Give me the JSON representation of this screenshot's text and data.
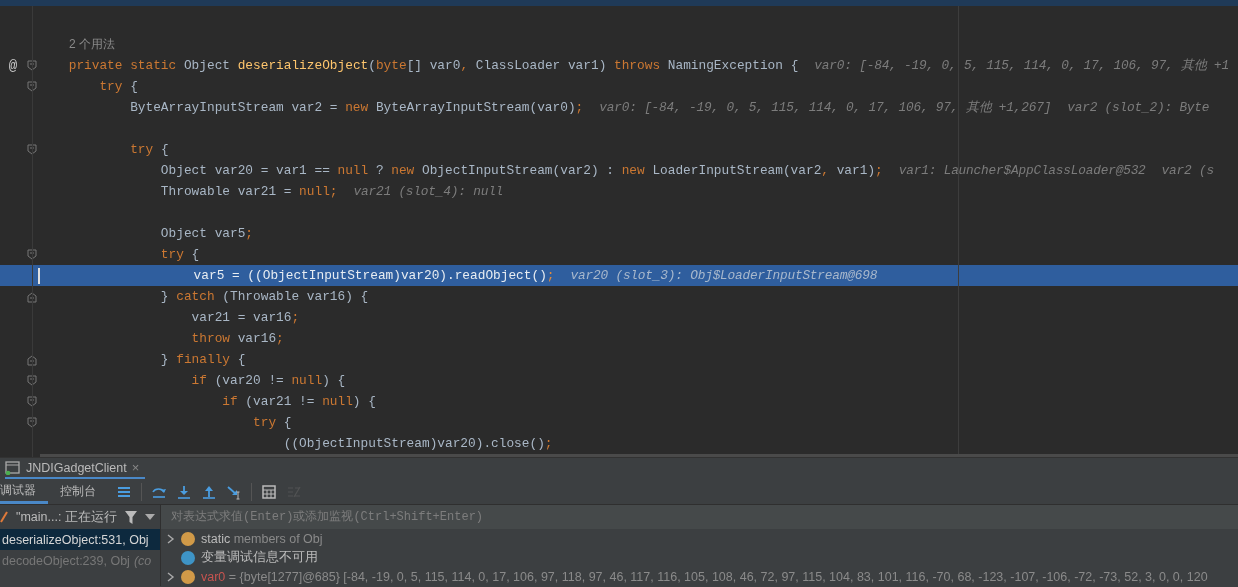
{
  "editor": {
    "lines": [
      {
        "usage": "2 个用法",
        "foldable": false,
        "highlighted": false
      },
      {
        "marker": "@",
        "tokens": [
          {
            "kind": "kw",
            "text": "    private static "
          },
          {
            "kind": "txt",
            "text": "Object "
          },
          {
            "kind": "fn",
            "text": "deserializeObject"
          },
          {
            "kind": "txt",
            "text": "("
          },
          {
            "kind": "kw",
            "text": "byte"
          },
          {
            "kind": "txt",
            "text": "[] var0"
          },
          {
            "kind": "kw",
            "text": ", "
          },
          {
            "kind": "txt",
            "text": "ClassLoader var1) "
          },
          {
            "kind": "kw",
            "text": "throws "
          },
          {
            "kind": "txt",
            "text": "NamingException {"
          }
        ],
        "hints": [
          "var0: [-84, -19, 0, 5, 115, 114, 0, 17, 106, 97, 其他 +1"
        ],
        "foldable": true,
        "fold_end": false,
        "highlighted": false
      },
      {
        "tokens": [
          {
            "kind": "kw",
            "text": "        try "
          },
          {
            "kind": "txt",
            "text": "{"
          }
        ],
        "foldable": true,
        "fold_end": false,
        "highlighted": false
      },
      {
        "tokens": [
          {
            "kind": "txt",
            "text": "            ByteArrayInputStream var2 = "
          },
          {
            "kind": "kw",
            "text": "new "
          },
          {
            "kind": "txt",
            "text": "ByteArrayInputStream(var0)"
          },
          {
            "kind": "kw",
            "text": ";"
          }
        ],
        "hints": [
          "var0: [-84, -19, 0, 5, 115, 114, 0, 17, 106, 97, 其他 +1,267]",
          "var2 (slot_2): Byte"
        ],
        "foldable": false,
        "highlighted": false
      },
      {
        "foldable": false,
        "highlighted": false
      },
      {
        "tokens": [
          {
            "kind": "kw",
            "text": "            try "
          },
          {
            "kind": "txt",
            "text": "{"
          }
        ],
        "foldable": true,
        "fold_end": false,
        "highlighted": false
      },
      {
        "tokens": [
          {
            "kind": "txt",
            "text": "                Object var20 = var1 == "
          },
          {
            "kind": "kw",
            "text": "null "
          },
          {
            "kind": "txt",
            "text": "? "
          },
          {
            "kind": "kw",
            "text": "new "
          },
          {
            "kind": "txt",
            "text": "ObjectInputStream(var2) : "
          },
          {
            "kind": "kw",
            "text": "new "
          },
          {
            "kind": "txt",
            "text": "LoaderInputStream(var2"
          },
          {
            "kind": "kw",
            "text": ", "
          },
          {
            "kind": "txt",
            "text": "var1)"
          },
          {
            "kind": "kw",
            "text": ";"
          }
        ],
        "hints": [
          "var1: Launcher$AppClassLoader@532",
          "var2 (s"
        ],
        "foldable": false,
        "highlighted": false
      },
      {
        "tokens": [
          {
            "kind": "txt",
            "text": "                Throwable var21 = "
          },
          {
            "kind": "kw",
            "text": "null;"
          }
        ],
        "hints": [
          "var21 (slot_4): null"
        ],
        "foldable": false,
        "highlighted": false
      },
      {
        "foldable": false,
        "highlighted": false
      },
      {
        "tokens": [
          {
            "kind": "txt",
            "text": "                Object var5"
          },
          {
            "kind": "kw",
            "text": ";"
          }
        ],
        "foldable": false,
        "highlighted": false
      },
      {
        "tokens": [
          {
            "kind": "kw",
            "text": "                try "
          },
          {
            "kind": "txt",
            "text": "{"
          }
        ],
        "foldable": true,
        "fold_end": false,
        "highlighted": false
      },
      {
        "tokens": [
          {
            "kind": "txt",
            "text": "                    var5 = ((ObjectInputStream)var20).readObject()"
          },
          {
            "kind": "kw",
            "text": ";"
          }
        ],
        "hints": [
          "var20 (slot_3): Obj$LoaderInputStream@698"
        ],
        "foldable": false,
        "highlighted": true
      },
      {
        "tokens": [
          {
            "kind": "txt",
            "text": "                } "
          },
          {
            "kind": "kw",
            "text": "catch "
          },
          {
            "kind": "txt",
            "text": "(Throwable var16) {"
          }
        ],
        "foldable": true,
        "fold_end": true,
        "highlighted": false
      },
      {
        "tokens": [
          {
            "kind": "txt",
            "text": "                    var21 = var16"
          },
          {
            "kind": "kw",
            "text": ";"
          }
        ],
        "foldable": false,
        "highlighted": false
      },
      {
        "tokens": [
          {
            "kind": "kw",
            "text": "                    throw "
          },
          {
            "kind": "txt",
            "text": "var16"
          },
          {
            "kind": "kw",
            "text": ";"
          }
        ],
        "foldable": false,
        "highlighted": false
      },
      {
        "tokens": [
          {
            "kind": "txt",
            "text": "                } "
          },
          {
            "kind": "kw",
            "text": "finally "
          },
          {
            "kind": "txt",
            "text": "{"
          }
        ],
        "foldable": true,
        "fold_end": true,
        "highlighted": false
      },
      {
        "tokens": [
          {
            "kind": "kw",
            "text": "                    if "
          },
          {
            "kind": "txt",
            "text": "(var20 != "
          },
          {
            "kind": "kw",
            "text": "null"
          },
          {
            "kind": "txt",
            "text": ") {"
          }
        ],
        "foldable": true,
        "fold_end": false,
        "highlighted": false
      },
      {
        "tokens": [
          {
            "kind": "kw",
            "text": "                        if "
          },
          {
            "kind": "txt",
            "text": "(var21 != "
          },
          {
            "kind": "kw",
            "text": "null"
          },
          {
            "kind": "txt",
            "text": ") {"
          }
        ],
        "foldable": true,
        "fold_end": false,
        "highlighted": false
      },
      {
        "tokens": [
          {
            "kind": "kw",
            "text": "                            try "
          },
          {
            "kind": "txt",
            "text": "{"
          }
        ],
        "foldable": true,
        "fold_end": false,
        "highlighted": false
      },
      {
        "tokens": [
          {
            "kind": "txt",
            "text": "                                ((ObjectInputStream)var20).close()"
          },
          {
            "kind": "kw",
            "text": ";"
          }
        ],
        "foldable": false,
        "highlighted": false
      }
    ]
  },
  "debug": {
    "session": {
      "label": "JNDIGadgetClient",
      "close": "×"
    },
    "tabs": [
      {
        "label": "调试器",
        "selected": true
      },
      {
        "label": "控制台",
        "selected": false
      }
    ],
    "toolbar": [
      {
        "kind": "menu",
        "disabled": false
      },
      {
        "kind": "step-over",
        "disabled": false
      },
      {
        "kind": "step-into",
        "disabled": false
      },
      {
        "kind": "step-out",
        "disabled": false
      },
      {
        "kind": "run-to-cursor",
        "disabled": false
      },
      {
        "kind": "evaluate",
        "disabled": false
      },
      {
        "kind": "trace",
        "disabled": true
      }
    ],
    "thread": {
      "label": "\"main...: 正在运行"
    },
    "frames": [
      {
        "text": "deserializeObject:531, Obj",
        "selected": true
      },
      {
        "text": "decodeObject:239, Obj",
        "note": "(co",
        "selected": false
      }
    ],
    "evaluate": {
      "placeholder": "对表达式求值(Enter)或添加监视(Ctrl+Shift+Enter)"
    },
    "variables": [
      {
        "kind": "static",
        "label": "static",
        "detail": "members of Obj",
        "expandable": true
      },
      {
        "kind": "info",
        "label": "变量调试信息不可用",
        "expandable": false
      },
      {
        "kind": "param",
        "label": "var0",
        "detail": "= {byte[1277]@685} [-84, -19, 0, 5, 115, 114, 0, 17, 106, 97, 118, 97, 46, 117, 116, 105, 108, 46, 72, 97, 115, 104, 83, 101, 116, -70, 68, -123, -107, -106, -72, -73, 52, 3, 0, 0, 120",
        "expandable": true
      }
    ]
  }
}
